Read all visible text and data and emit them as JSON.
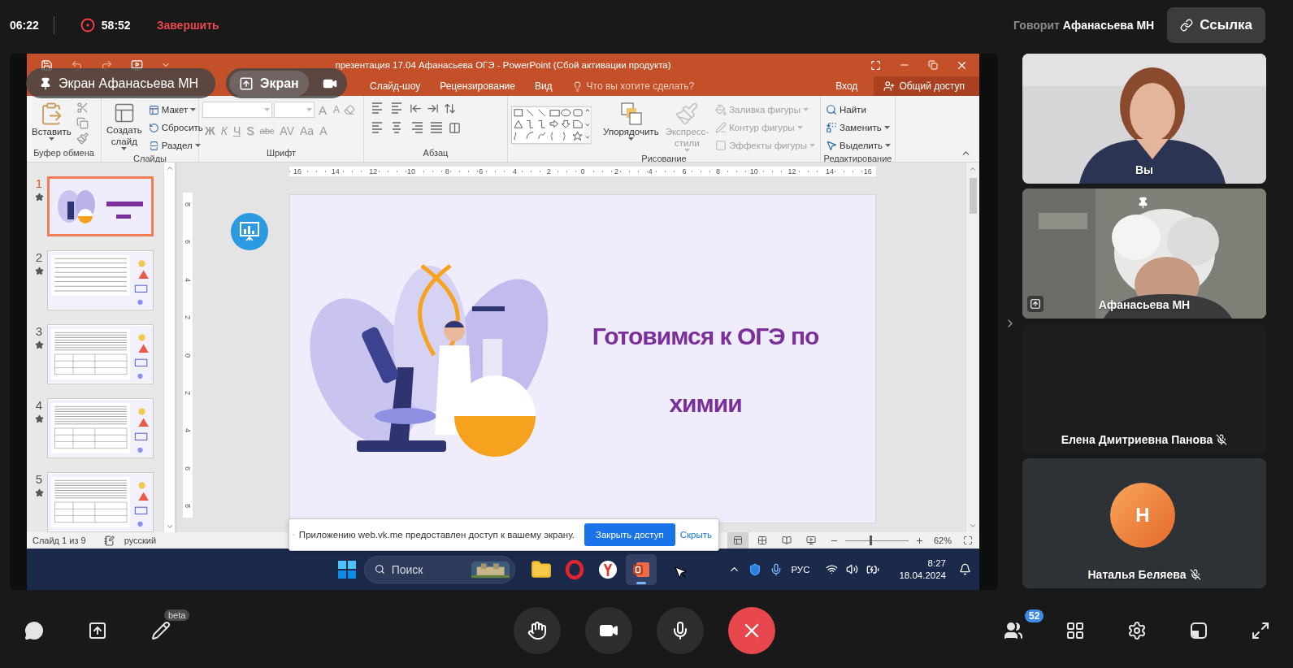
{
  "top_bar": {
    "time": "06:22",
    "recording": {
      "on": true,
      "duration": "58:52"
    },
    "end_label": "Завершить",
    "speaker_label": "Говорит",
    "speaker_name": "Афанасьева МН",
    "link_button": "Ссылка"
  },
  "screen_labels": [
    {
      "kind": "owner",
      "label": "Экран Афанасьева МН"
    },
    {
      "kind": "share",
      "label": "Экран"
    }
  ],
  "powerpoint": {
    "title": "презентация 17.04 Афанасьева ОГЭ - PowerPoint (Сбой активации продукта)",
    "tabs": [
      "Слайд-шоу",
      "Рецензирование",
      "Вид"
    ],
    "tell_me": "Что вы хотите сделать?",
    "sign_in": "Вход",
    "share": "Общий доступ",
    "clipboard": {
      "label": "Буфер обмена",
      "paste": "Вставить"
    },
    "slides_group": {
      "label": "Слайды",
      "new_slide": "Создать слайд",
      "items": [
        {
          "kind": "layout",
          "label": "Макет"
        },
        {
          "kind": "reset",
          "label": "Сбросить"
        },
        {
          "kind": "section",
          "label": "Раздел"
        }
      ]
    },
    "font": {
      "label": "Шрифт",
      "disabled": true,
      "size_buttons": [
        {
          "kind": "grow",
          "label": "A"
        },
        {
          "kind": "shrink",
          "label": "A"
        }
      ],
      "style_buttons": [
        {
          "kind": "bold",
          "label": "Ж"
        },
        {
          "kind": "italic",
          "label": "К"
        },
        {
          "kind": "underline",
          "label": "Ч"
        },
        {
          "kind": "shadow",
          "label": "S"
        },
        {
          "kind": "strikethrough",
          "label": "abc"
        },
        {
          "kind": "spacing",
          "label": "AV"
        },
        {
          "kind": "case",
          "label": "Aa"
        },
        {
          "kind": "color",
          "label": "A"
        }
      ]
    },
    "paragraph": {
      "label": "Абзац"
    },
    "drawing": {
      "label": "Рисование",
      "arrange": "Упорядочить",
      "quick_styles": {
        "label": "Экспресс-стили",
        "disabled": true
      },
      "format": [
        {
          "kind": "fill",
          "label": "Заливка фигуры",
          "disabled": true
        },
        {
          "kind": "outline",
          "label": "Контур фигуры",
          "disabled": true
        },
        {
          "kind": "effects",
          "label": "Эффекты фигуры",
          "disabled": true
        }
      ]
    },
    "editing": {
      "label": "Редактирование",
      "items": [
        {
          "kind": "find",
          "label": "Найти"
        },
        {
          "kind": "replace",
          "label": "Заменить"
        },
        {
          "kind": "select",
          "label": "Выделить"
        }
      ]
    },
    "thumbnails": [
      {
        "number": "1",
        "kind": "title",
        "selected": true
      },
      {
        "number": "2",
        "kind": "text",
        "selected": false
      },
      {
        "number": "3",
        "kind": "table",
        "selected": false
      },
      {
        "number": "4",
        "kind": "table",
        "selected": false
      },
      {
        "number": "5",
        "kind": "table",
        "selected": false
      }
    ],
    "ruler_h": [
      "16",
      "14",
      "12",
      "10",
      "8",
      "6",
      "4",
      "2",
      "0",
      "2",
      "4",
      "6",
      "8",
      "10",
      "12",
      "14",
      "16"
    ],
    "ruler_v": [
      "8",
      "6",
      "4",
      "2",
      "0",
      "2",
      "4",
      "6",
      "8"
    ],
    "slide": {
      "title_lines": [
        "Готовимся к ОГЭ по",
        "химии"
      ]
    },
    "status": {
      "slide_counter": "Слайд 1 из 9",
      "language": "русский",
      "views": [
        {
          "kind": "normal",
          "selected": true
        },
        {
          "kind": "sorter",
          "selected": false
        },
        {
          "kind": "reading",
          "selected": false
        },
        {
          "kind": "slideshow",
          "selected": false
        }
      ],
      "zoom": {
        "level": 0.38,
        "reading": "62%"
      }
    },
    "share_notice": {
      "text": "Приложению web.vk.me предоставлен доступ к вашему экрану.",
      "stop_button": "Закрыть доступ",
      "hide_link": "Скрыть"
    },
    "taskbar": {
      "search_placeholder": "Поиск",
      "apps": [
        {
          "kind": "explorer",
          "selected": false
        },
        {
          "kind": "opera",
          "selected": false
        },
        {
          "kind": "yandex",
          "selected": false
        },
        {
          "kind": "powerpoint",
          "selected": true
        }
      ],
      "language": "РУС",
      "time": "8:27",
      "date": "18.04.2024"
    }
  },
  "participants": [
    {
      "name": "Вы",
      "kind": "camera",
      "pinned": false,
      "speaking": false,
      "sharing": false,
      "muted": false
    },
    {
      "name": "Афанасьева МН",
      "kind": "camera",
      "pinned": true,
      "speaking": true,
      "sharing": true,
      "muted": false
    },
    {
      "name": "Елена Дмитриевна Панова",
      "kind": "no_video",
      "pinned": false,
      "speaking": false,
      "sharing": false,
      "muted": true
    },
    {
      "name": "Наталья Беляева",
      "kind": "avatar",
      "initial": "Н",
      "pinned": false,
      "speaking": false,
      "sharing": false,
      "muted": true
    }
  ],
  "bottom_bar": {
    "tools": [
      {
        "kind": "chat"
      },
      {
        "kind": "share"
      },
      {
        "kind": "draw",
        "badge": "beta"
      }
    ],
    "controls": [
      {
        "kind": "hand"
      },
      {
        "kind": "camera"
      },
      {
        "kind": "mic"
      },
      {
        "kind": "end"
      }
    ],
    "right": [
      {
        "kind": "participants",
        "badge": "52"
      },
      {
        "kind": "grid"
      },
      {
        "kind": "settings"
      },
      {
        "kind": "layout"
      },
      {
        "kind": "fullscreen"
      }
    ]
  }
}
